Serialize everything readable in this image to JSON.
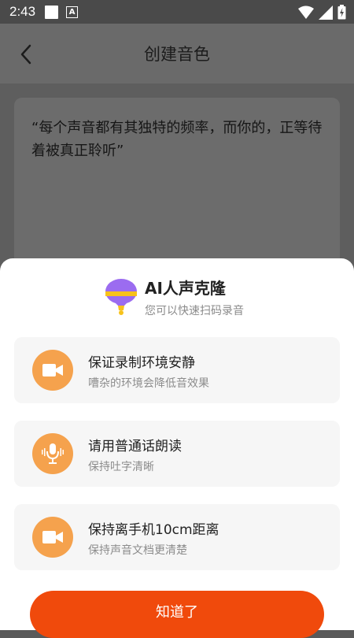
{
  "status_bar": {
    "time": "2:43",
    "notification_letter": "A",
    "icons": [
      "wifi-icon",
      "signal-icon",
      "battery-charging-icon"
    ]
  },
  "header": {
    "title": "创建音色",
    "back_icon": "chevron-left-icon"
  },
  "quote": {
    "text": "“每个声音都有其独特的频率，而你的，正等待着被真正聆听”"
  },
  "sheet": {
    "title": "AI人声克隆",
    "subtitle": "您可以快速扫码录音",
    "badge_icon": "microphone-badge-icon",
    "tips": [
      {
        "icon": "video-camera-icon",
        "title": "保证录制环境安静",
        "desc": "嘈杂的环境会降低音效果"
      },
      {
        "icon": "microphone-icon",
        "title": "请用普通话朗读",
        "desc": "保持吐字清晰"
      },
      {
        "icon": "video-camera-icon",
        "title": "保持离手机10cm距离",
        "desc": "保持声音文档更清楚"
      }
    ],
    "confirm_label": "知道了"
  },
  "colors": {
    "accent_orange": "#f04a0c",
    "icon_orange": "#f5a24d",
    "badge_purple": "#9b6cf0",
    "badge_yellow": "#f7c21b"
  }
}
